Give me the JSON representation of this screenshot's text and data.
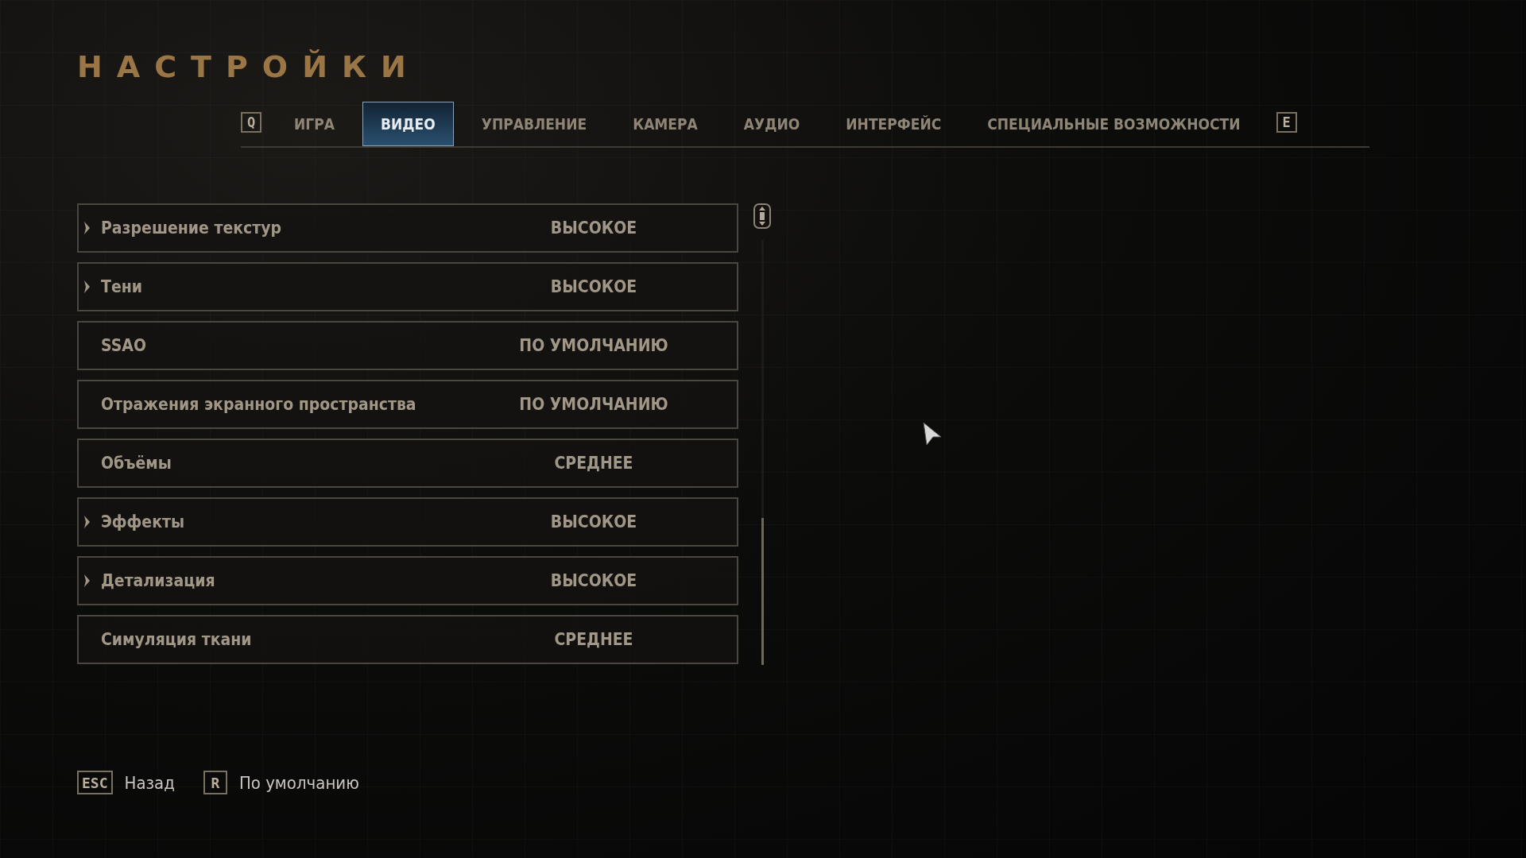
{
  "title": "НАСТРОЙКИ",
  "tabs": {
    "prev_key": "Q",
    "next_key": "E",
    "items": [
      {
        "label": "ИГРА",
        "selected": false
      },
      {
        "label": "ВИДЕО",
        "selected": true
      },
      {
        "label": "УПРАВЛЕНИЕ",
        "selected": false
      },
      {
        "label": "КАМЕРА",
        "selected": false
      },
      {
        "label": "АУДИО",
        "selected": false
      },
      {
        "label": "ИНТЕРФЕЙС",
        "selected": false
      },
      {
        "label": "СПЕЦИАЛЬНЫЕ ВОЗМОЖНОСТИ",
        "selected": false
      }
    ]
  },
  "settings": [
    {
      "label": "Разрешение текстур",
      "value": "ВЫСОКОЕ",
      "expandable": true
    },
    {
      "label": "Тени",
      "value": "ВЫСОКОЕ",
      "expandable": true
    },
    {
      "label": "SSAO",
      "value": "ПО УМОЛЧАНИЮ",
      "expandable": false
    },
    {
      "label": "Отражения экранного пространства",
      "value": "ПО УМОЛЧАНИЮ",
      "expandable": false
    },
    {
      "label": "Объёмы",
      "value": "СРЕДНЕЕ",
      "expandable": false
    },
    {
      "label": "Эффекты",
      "value": "ВЫСОКОЕ",
      "expandable": true
    },
    {
      "label": "Детализация",
      "value": "ВЫСОКОЕ",
      "expandable": true
    },
    {
      "label": "Симуляция ткани",
      "value": "СРЕДНЕЕ",
      "expandable": false
    }
  ],
  "footer": [
    {
      "key": "ESC",
      "label": "Назад"
    },
    {
      "key": "R",
      "label": "По умолчанию"
    }
  ]
}
